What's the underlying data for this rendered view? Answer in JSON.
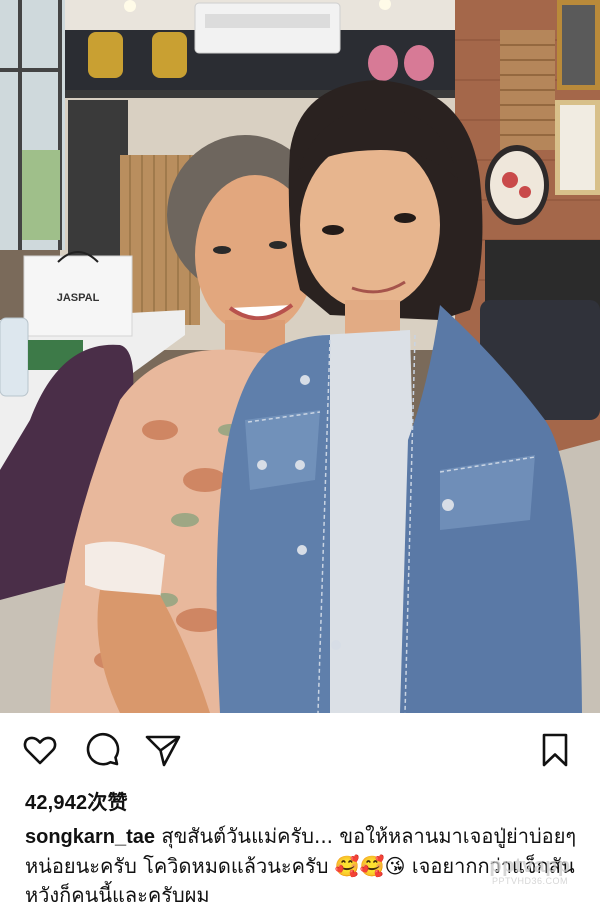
{
  "post": {
    "likes_text": "42,942次赞",
    "username": "songkarn_tae",
    "caption_text": "สุขสันต์วันแม่ครับ... ขอให้หลานมาเจอปู่ย่าบ่อยๆหน่อยนะครับ โควิดหมดแล้วนะครับ 🥰🥰😘 เจอยากกว่าแจ็กสัน หวังก็คนนี้และครับผม",
    "bag_brand": "JASPAL"
  },
  "icons": {
    "like": "heart-icon",
    "comment": "comment-bubble-icon",
    "share": "paper-plane-icon",
    "save": "bookmark-icon"
  },
  "watermark": {
    "main": "pptvapp",
    "sub": "PPTVHD36.COM"
  },
  "colors": {
    "icon_stroke": "#111111",
    "text": "#111111",
    "background": "#ffffff"
  }
}
